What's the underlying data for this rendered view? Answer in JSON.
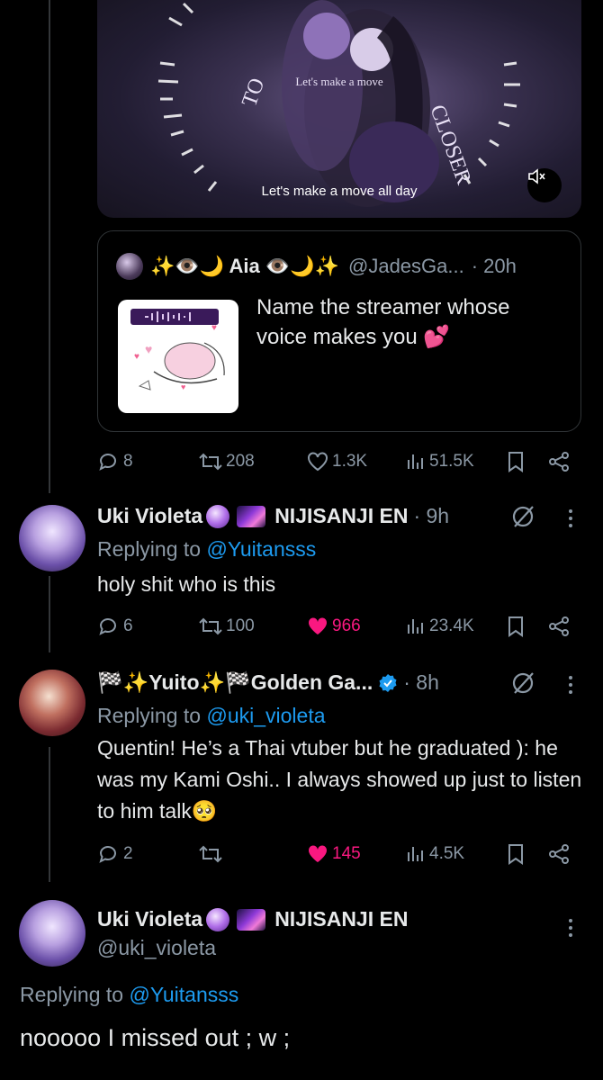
{
  "media": {
    "caption": "Let's make a move all day",
    "overlay_text": "Let's make a move",
    "mute_icon": "volume-mute-icon"
  },
  "quote": {
    "name": "✨👁️🌙 Aia 👁️🌙✨",
    "handle": "@JadesGa...",
    "time": "· 20h",
    "text": "Name the streamer whose voice makes you 💕"
  },
  "post_actions": {
    "replies": "8",
    "reposts": "208",
    "likes": "1.3K",
    "views": "51.5K"
  },
  "replies": [
    {
      "name": "Uki Violeta",
      "org": "NIJISANJI EN",
      "time": "· 9h",
      "replying_label": "Replying to",
      "replying_to": "@Yuitansss",
      "text": "holy shit who is this",
      "actions": {
        "replies": "6",
        "reposts": "100",
        "likes": "966",
        "views": "23.4K"
      }
    },
    {
      "name": "🏁✨Yuito✨🏁Golden Ga...",
      "time": "· 8h",
      "replying_label": "Replying to",
      "replying_to": "@uki_violeta",
      "text": "Quentin! He’s a Thai vtuber but he graduated ): he was my Kami Oshi.. I always showed up just to listen to him talk🥺",
      "actions": {
        "replies": "2",
        "reposts": "",
        "likes": "145",
        "views": "4.5K"
      }
    }
  ],
  "focused": {
    "name": "Uki Violeta",
    "org": "NIJISANJI EN",
    "handle": "@uki_violeta",
    "replying_label": "Replying to",
    "replying_to": "@Yuitansss",
    "text": "nooooo I missed out ; w ;"
  },
  "colors": {
    "accent": "#1d9bf0",
    "like": "#f91880",
    "muted": "#8b98a5",
    "background": "#000000"
  }
}
